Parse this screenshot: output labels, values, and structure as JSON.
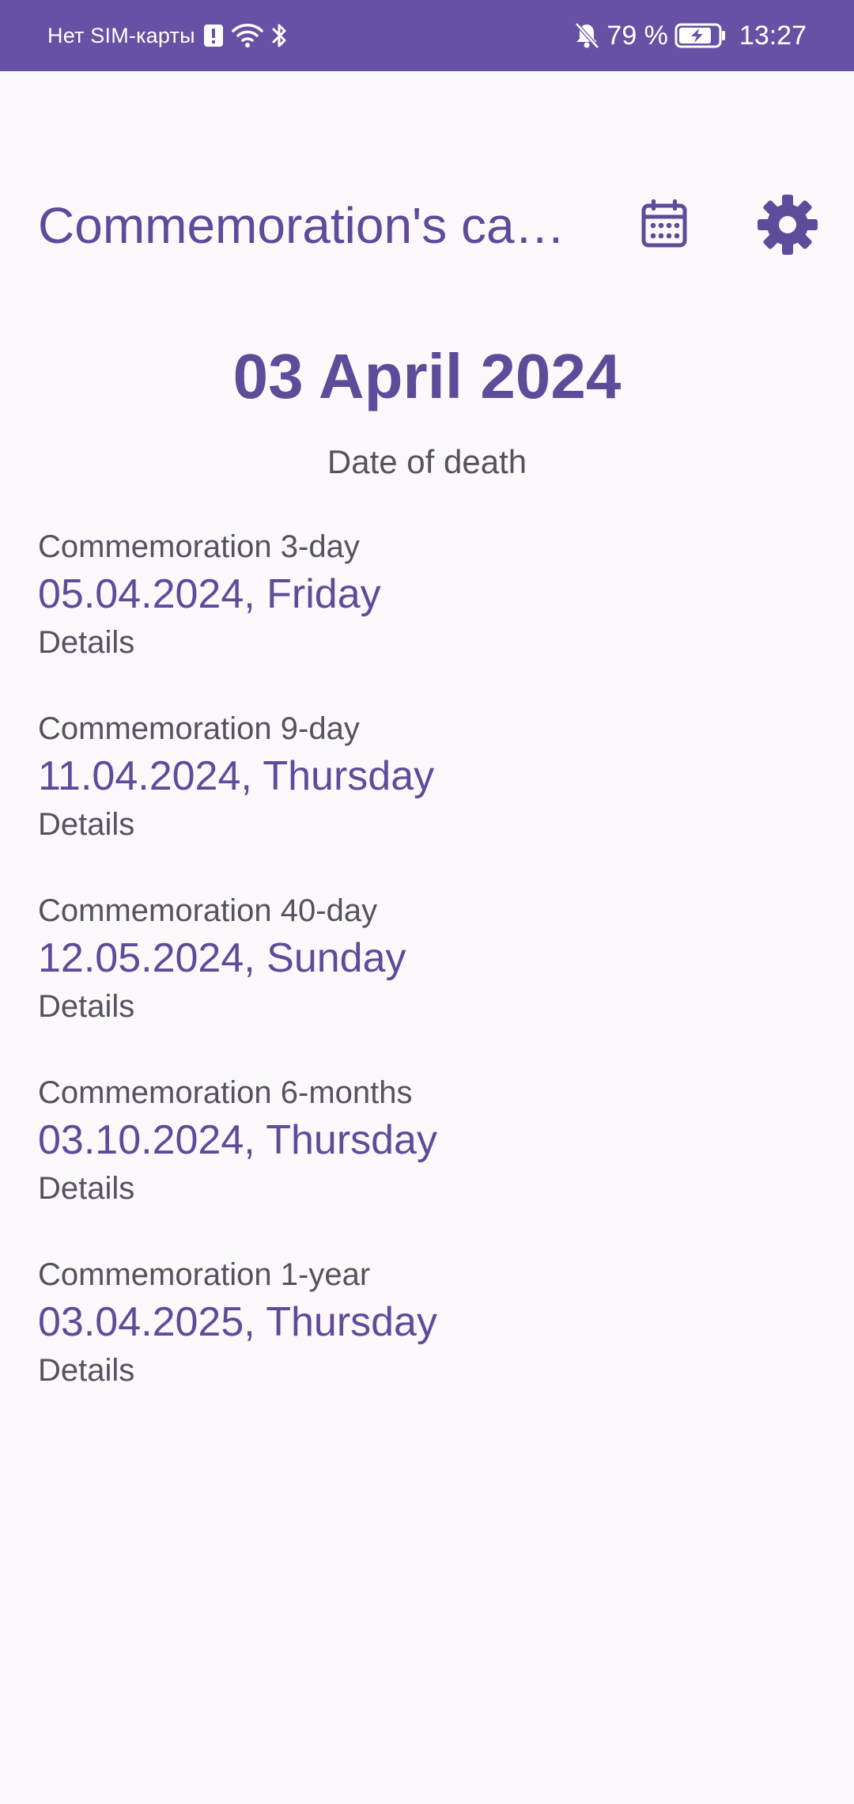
{
  "status_bar": {
    "carrier": "Нет SIM-карты",
    "battery_percent": "79 %",
    "time": "13:27",
    "icons": [
      "alert-icon",
      "wifi-icon",
      "bluetooth-icon",
      "bell-off-icon",
      "battery-charging-icon"
    ]
  },
  "app_bar": {
    "title": "Commemoration's ca…",
    "calendar_icon": "calendar-icon",
    "settings_icon": "gear-icon"
  },
  "main": {
    "death_date": "03 April 2024",
    "death_label": "Date of death"
  },
  "commemorations": [
    {
      "title": "Commemoration 3-day",
      "date": "05.04.2024, Friday",
      "details": "Details"
    },
    {
      "title": "Commemoration 9-day",
      "date": "11.04.2024, Thursday",
      "details": "Details"
    },
    {
      "title": "Commemoration 40-day",
      "date": "12.05.2024, Sunday",
      "details": "Details"
    },
    {
      "title": "Commemoration 6-months",
      "date": "03.10.2024, Thursday",
      "details": "Details"
    },
    {
      "title": "Commemoration 1-year",
      "date": "03.04.2025, Thursday",
      "details": "Details"
    }
  ],
  "colors": {
    "status_bar": "#6651a4",
    "accent": "#5c4c9a",
    "background": "#fdf8fc",
    "secondary_text": "#55525e"
  }
}
